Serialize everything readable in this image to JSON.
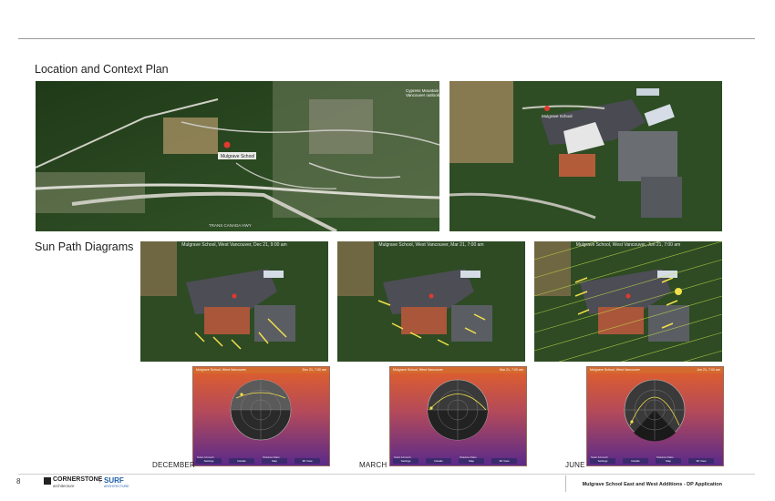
{
  "sections": {
    "location_title": "Location and Context Plan",
    "sunpath_title": "Sun Path Diagrams"
  },
  "map_labels": {
    "school_pin": "Mulgrave School",
    "aerial_school_pin": "Mulgrave School",
    "cypress": "Cypress Mountain\nVancouver outlook",
    "highway": "TRANS CANADA HWY"
  },
  "sun_captions": {
    "dec": "Mulgrave School, West Vancouver, Dec 21, 9:00 am",
    "mar": "Mulgrave School, West Vancouver, Mar 21, 7:00 am",
    "jun": "Mulgrave School, West Vancouver, Jun 21, 7:00 am"
  },
  "cards": {
    "dec": {
      "header_left": "Mulgrave School, West Vancouver",
      "header_right": "Dec 21, 7:00 am"
    },
    "mar": {
      "header_left": "Mulgrave School, West Vancouver",
      "header_right": "Mar 21, 7:00 am"
    },
    "jun": {
      "header_left": "Mulgrave School, West Vancouver",
      "header_right": "Jun 21, 7:00 am"
    },
    "stat_labels": [
      "Solar Azimuth",
      "Elevation",
      "Shadow Ratio",
      "Path Length"
    ],
    "buttons": [
      "Settings",
      "Details",
      "Map",
      "3D View"
    ]
  },
  "months": [
    "DECEMBER",
    "MARCH",
    "JUNE"
  ],
  "footer": {
    "page_number": "8",
    "logo_cornerstone": "CORNERSTONE",
    "logo_cornerstone_sub": "architecture",
    "logo_surf": "SURF",
    "logo_surf_sub": "ARCHITECTURE",
    "project_title": "Mulgrave School East and West Additions - DP Application"
  },
  "colors": {
    "rule": "#9a9a9a",
    "forest": "#2c4a22",
    "card_header": "#d46a2e",
    "card_gradient_top": "#e0602a",
    "card_gradient_bottom": "#5a2a8a",
    "surf_blue": "#1f5fa8"
  }
}
